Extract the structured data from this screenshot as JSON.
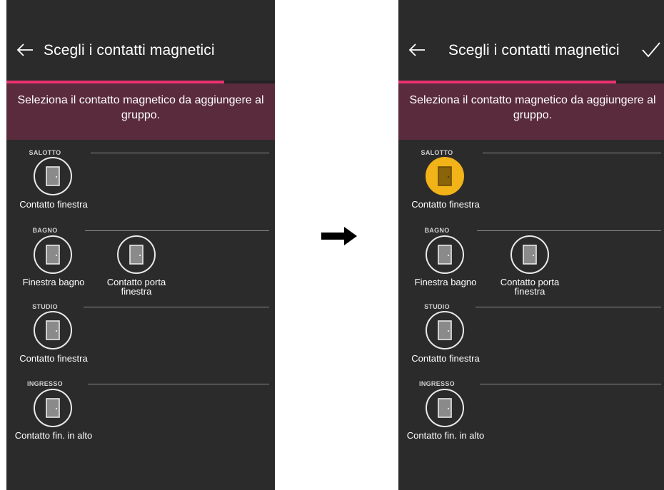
{
  "screens": [
    {
      "title": "Scegli i contatti magnetici",
      "instruction": "Seleziona il contatto magnetico da aggiungere al gruppo.",
      "progress_percent": 81,
      "show_confirm": false,
      "groups": [
        {
          "name": "SALOTTO",
          "devices": [
            {
              "name": "Contatto finestra",
              "selected": false
            }
          ]
        },
        {
          "name": "BAGNO",
          "devices": [
            {
              "name": "Finestra bagno",
              "selected": false
            },
            {
              "name": "Contatto porta finestra",
              "selected": false
            }
          ]
        },
        {
          "name": "STUDIO",
          "devices": [
            {
              "name": "Contatto finestra",
              "selected": false
            }
          ]
        },
        {
          "name": "INGRESSO",
          "devices": [
            {
              "name": "Contatto fin. in alto",
              "selected": false
            }
          ]
        }
      ]
    },
    {
      "title": "Scegli i contatti magnetici",
      "instruction": "Seleziona il contatto magnetico da aggiungere al gruppo.",
      "progress_percent": 81,
      "show_confirm": true,
      "groups": [
        {
          "name": "SALOTTO",
          "devices": [
            {
              "name": "Contatto finestra",
              "selected": true
            }
          ]
        },
        {
          "name": "BAGNO",
          "devices": [
            {
              "name": "Finestra bagno",
              "selected": false
            },
            {
              "name": "Contatto porta finestra",
              "selected": false
            }
          ]
        },
        {
          "name": "STUDIO",
          "devices": [
            {
              "name": "Contatto finestra",
              "selected": false
            }
          ]
        },
        {
          "name": "INGRESSO",
          "devices": [
            {
              "name": "Contatto fin. in alto",
              "selected": false
            }
          ]
        }
      ]
    }
  ],
  "transition_icon": "right-arrow-icon",
  "colors": {
    "background": "#2b2b2b",
    "banner": "#5a2b3d",
    "progress": "#e8336f",
    "selected": "#f2b318",
    "text": "#ffffff"
  }
}
